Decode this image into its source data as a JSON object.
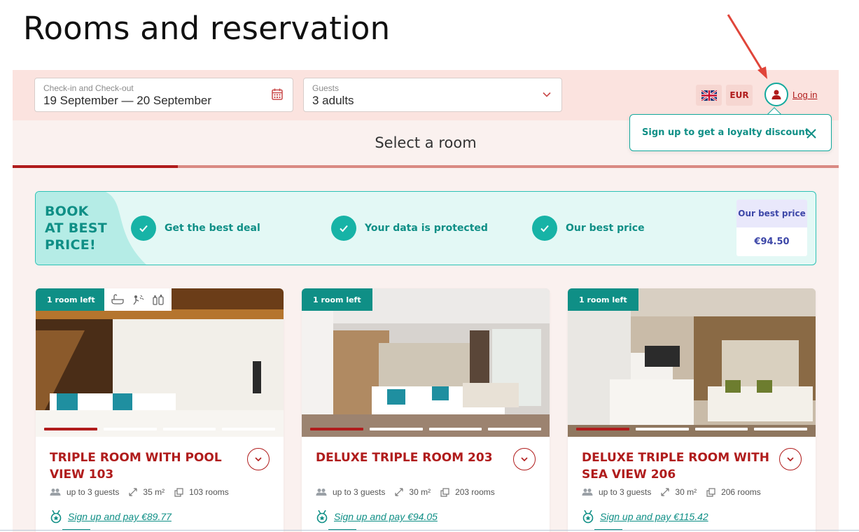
{
  "page": {
    "title": "Rooms and reservation"
  },
  "search": {
    "dates": {
      "label": "Check-in and Check-out",
      "value": "19 September — 20 September"
    },
    "guests": {
      "label": "Guests",
      "value": "3 adults"
    }
  },
  "header": {
    "language_icon": "uk-flag-icon",
    "currency": "EUR",
    "login_label": "Log in"
  },
  "steps": {
    "title": "Select a room",
    "progress": 0.2
  },
  "loyalty_popup": {
    "text": "Sign up to get a loyalty discount"
  },
  "promo": {
    "headline": [
      "BOOK",
      "AT BEST",
      "PRICE!"
    ],
    "features": [
      "Get the best deal",
      "Your data is protected",
      "Our best price"
    ],
    "best_price_label": "Our best price",
    "best_price_value": "€94.50"
  },
  "rooms": [
    {
      "badge": "1 room left",
      "name_lines": [
        "TRIPLE ROOM WITH POOL",
        "VIEW 103"
      ],
      "guests": "up to 3 guests",
      "area": "35 m²",
      "rooms": "103 rooms",
      "signup_price": "Sign up and pay €89.77",
      "amenities": [
        "bathtub-icon",
        "shower-icon",
        "toiletries-icon"
      ]
    },
    {
      "badge": "1 room left",
      "name_lines": [
        "DELUXE TRIPLE ROOM 203",
        ""
      ],
      "guests": "up to 3 guests",
      "area": "30 m²",
      "rooms": "203 rooms",
      "signup_price": "Sign up and pay €94.05"
    },
    {
      "badge": "1 room left",
      "name_lines": [
        "DELUXE TRIPLE ROOM WITH",
        "SEA VIEW 206"
      ],
      "guests": "up to 3 guests",
      "area": "30 m²",
      "rooms": "206 rooms",
      "signup_price": "Sign up and pay €115.42"
    }
  ],
  "colors": {
    "brand_red": "#b01c1c",
    "teal": "#0f8f86",
    "annotation_arrow": "#e0453a"
  }
}
